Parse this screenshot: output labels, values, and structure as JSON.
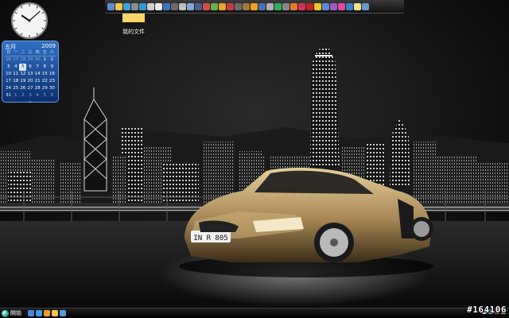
{
  "desktop": {
    "wallpaper": {
      "subject": "night city skyline with gold sports car",
      "plate_text": "IN R 805"
    },
    "icons": [
      {
        "label": "我的文件",
        "icon": "folder-icon"
      }
    ]
  },
  "gadgets": {
    "clock": {
      "hour": 10,
      "minute": 8
    },
    "calendar": {
      "month": "五月",
      "year": "2009",
      "weekdays": [
        "日",
        "一",
        "二",
        "三",
        "四",
        "五",
        "六"
      ],
      "weeks": [
        [
          "26",
          "27",
          "28",
          "29",
          "30",
          "1",
          "2"
        ],
        [
          "3",
          "4",
          "5",
          "6",
          "7",
          "8",
          "9"
        ],
        [
          "10",
          "11",
          "12",
          "13",
          "14",
          "15",
          "16"
        ],
        [
          "17",
          "18",
          "19",
          "20",
          "21",
          "22",
          "23"
        ],
        [
          "24",
          "25",
          "26",
          "27",
          "28",
          "29",
          "30"
        ],
        [
          "31",
          "1",
          "2",
          "3",
          "4",
          "5",
          "6"
        ]
      ],
      "today": "5"
    }
  },
  "dock": {
    "items": [
      {
        "icon": "network-icon",
        "color": "#5b8fd6"
      },
      {
        "icon": "folder-icon",
        "color": "#f3c64a"
      },
      {
        "icon": "globe-icon",
        "color": "#3aa3e0"
      },
      {
        "icon": "trash-icon",
        "color": "#8c8c8c"
      },
      {
        "icon": "refresh-icon",
        "color": "#2e9bd6"
      },
      {
        "icon": "search-icon",
        "color": "#d0d0d0"
      },
      {
        "icon": "clock-icon",
        "color": "#e8e8e8"
      },
      {
        "icon": "music-icon",
        "color": "#3b74c9"
      },
      {
        "icon": "phone-icon",
        "color": "#6b6b6b"
      },
      {
        "icon": "disc-icon",
        "color": "#c0c0c0"
      },
      {
        "icon": "settings-icon",
        "color": "#7fa7d6"
      },
      {
        "icon": "video-icon",
        "color": "#4a5c8a"
      },
      {
        "icon": "paint-icon",
        "color": "#d34d4d"
      },
      {
        "icon": "chart-icon",
        "color": "#66b04a"
      },
      {
        "icon": "mail-icon",
        "color": "#e3a628"
      },
      {
        "icon": "shield-icon",
        "color": "#c43c3c"
      },
      {
        "icon": "camera-icon",
        "color": "#6a6a6a"
      },
      {
        "icon": "tool-icon",
        "color": "#9a7a3a"
      },
      {
        "icon": "star-icon",
        "color": "#f0a020"
      },
      {
        "icon": "text-icon",
        "color": "#4b6fb0"
      },
      {
        "icon": "book-icon",
        "color": "#b0b0b0"
      },
      {
        "icon": "play-icon",
        "color": "#2fae5a"
      },
      {
        "icon": "image-icon",
        "color": "#888888"
      },
      {
        "icon": "firefox-icon",
        "color": "#e8762b"
      },
      {
        "icon": "flower-icon",
        "color": "#d2335a"
      },
      {
        "icon": "pdf-icon",
        "color": "#c82020"
      },
      {
        "icon": "chat-icon",
        "color": "#e9c531"
      },
      {
        "icon": "lock-icon",
        "color": "#5d8ad0"
      },
      {
        "icon": "people-icon",
        "color": "#9a59c6"
      },
      {
        "icon": "palette-icon",
        "color": "#e34aa0"
      },
      {
        "icon": "photo-icon",
        "color": "#3c82c6"
      },
      {
        "icon": "note-icon",
        "color": "#f2e28a"
      },
      {
        "icon": "computer-icon",
        "color": "#6699cc"
      }
    ]
  },
  "taskbar": {
    "start_label": "開始",
    "quicklaunch": [
      {
        "icon": "desktop-icon",
        "color": "#4a86d8"
      },
      {
        "icon": "ie-icon",
        "color": "#3a9ee0"
      },
      {
        "icon": "media-icon",
        "color": "#f29b2b"
      },
      {
        "icon": "folder-icon",
        "color": "#f3c64a"
      },
      {
        "icon": "mail-icon",
        "color": "#5c9ad8"
      }
    ],
    "tray": [
      {
        "icon": "volume-icon",
        "color": "#c8c8c8"
      },
      {
        "icon": "network-icon",
        "color": "#6ab0e8"
      },
      {
        "icon": "shield-icon",
        "color": "#d04545"
      },
      {
        "icon": "battery-icon",
        "color": "#8fd06a"
      }
    ]
  },
  "watermark": "#164106"
}
